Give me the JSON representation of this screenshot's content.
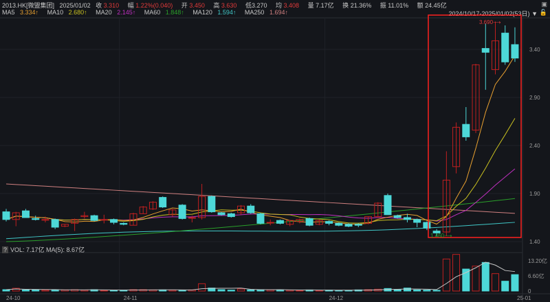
{
  "header": {
    "symbol": "2013.HK[微盟集团]",
    "date": "2025/01/02",
    "close_label": "收",
    "close": "3.310",
    "change_label": "幅",
    "change": "1.22%(0.040)",
    "open_label": "开",
    "open": "3.450",
    "high_label": "高",
    "high": "3.630",
    "low_label": "低",
    "low": "3.270",
    "avg_label": "均",
    "avg": "3.408",
    "volume_label": "量",
    "volume": "7.17亿",
    "turnover_label": "换",
    "turnover": "21.36%",
    "amplitude_label": "振",
    "amplitude": "11.01%",
    "amount_label": "额",
    "amount": "24.45亿",
    "date_range": "2024/10/17-2025/01/02(53日)"
  },
  "ma_legend": [
    {
      "label": "MA5",
      "value": "3.334↑",
      "color": "#e8a030"
    },
    {
      "label": "MA10",
      "value": "2.680↑",
      "color": "#c8c020"
    },
    {
      "label": "MA20",
      "value": "2.145↑",
      "color": "#c030c0"
    },
    {
      "label": "MA60",
      "value": "1.848↑",
      "color": "#2aa02a"
    },
    {
      "label": "MA120",
      "value": "1.594↑",
      "color": "#40c8c8"
    },
    {
      "label": "MA250",
      "value": "1.694↑",
      "color": "#d08080"
    }
  ],
  "volume_header": {
    "q": "?",
    "text": "VOL: 7.17亿 MA(5): 8.67亿"
  },
  "colors": {
    "up": "#c02020",
    "down": "#4dd8d8",
    "highlight": "#ff2020"
  },
  "chart_data": {
    "type": "candlestick",
    "price_ticks": [
      "3.40",
      "2.90",
      "2.40",
      "1.90",
      "1.40"
    ],
    "price_tick_values": [
      3.4,
      2.9,
      2.4,
      1.9,
      1.4
    ],
    "ylim": [
      1.4,
      3.7
    ],
    "volume_ticks": [
      "13.20亿",
      "6.60亿",
      "0"
    ],
    "volume_tick_values": [
      13.2,
      6.6,
      0
    ],
    "x_ticks": [
      {
        "label": "24-10",
        "index": 0
      },
      {
        "label": "24-11",
        "index": 12
      },
      {
        "label": "24-12",
        "index": 33
      },
      {
        "label": "25-01",
        "index": 53
      }
    ],
    "max_label": "3.690⟶",
    "min_label": "1.460⟶",
    "ohlc": [
      [
        1.71,
        1.74,
        1.61,
        1.63
      ],
      [
        1.63,
        1.71,
        1.56,
        1.7
      ],
      [
        1.72,
        1.74,
        1.66,
        1.65
      ],
      [
        1.64,
        1.67,
        1.62,
        1.63
      ],
      [
        1.63,
        1.66,
        1.6,
        1.63
      ],
      [
        1.63,
        1.64,
        1.53,
        1.55
      ],
      [
        1.56,
        1.58,
        1.55,
        1.58
      ],
      [
        1.59,
        1.64,
        1.51,
        1.63
      ],
      [
        1.66,
        1.71,
        1.64,
        1.67
      ],
      [
        1.67,
        1.68,
        1.61,
        1.62
      ],
      [
        1.63,
        1.68,
        1.59,
        1.63
      ],
      [
        1.63,
        1.64,
        1.58,
        1.6
      ],
      [
        1.59,
        1.6,
        1.57,
        1.58
      ],
      [
        1.57,
        1.7,
        1.57,
        1.69
      ],
      [
        1.69,
        1.77,
        1.69,
        1.76
      ],
      [
        1.74,
        1.82,
        1.73,
        1.81
      ],
      [
        1.86,
        1.87,
        1.75,
        1.76
      ],
      [
        1.68,
        1.74,
        1.66,
        1.73
      ],
      [
        1.78,
        1.79,
        1.63,
        1.64
      ],
      [
        1.65,
        1.67,
        1.6,
        1.65
      ],
      [
        1.65,
        2.0,
        1.63,
        1.87
      ],
      [
        1.87,
        1.88,
        1.7,
        1.71
      ],
      [
        1.7,
        1.71,
        1.67,
        1.68
      ],
      [
        1.69,
        1.7,
        1.65,
        1.66
      ],
      [
        1.7,
        1.78,
        1.68,
        1.77
      ],
      [
        1.77,
        1.79,
        1.69,
        1.7
      ],
      [
        1.69,
        1.7,
        1.58,
        1.59
      ],
      [
        1.6,
        1.63,
        1.57,
        1.6
      ],
      [
        1.62,
        1.63,
        1.58,
        1.59
      ],
      [
        1.58,
        1.62,
        1.56,
        1.62
      ],
      [
        1.61,
        1.64,
        1.59,
        1.63
      ],
      [
        1.64,
        1.65,
        1.56,
        1.57
      ],
      [
        1.58,
        1.63,
        1.57,
        1.62
      ],
      [
        1.61,
        1.62,
        1.57,
        1.59
      ],
      [
        1.59,
        1.6,
        1.56,
        1.57
      ],
      [
        1.58,
        1.59,
        1.55,
        1.56
      ],
      [
        1.58,
        1.59,
        1.55,
        1.57
      ],
      [
        1.59,
        1.66,
        1.58,
        1.66
      ],
      [
        1.66,
        1.81,
        1.65,
        1.8
      ],
      [
        1.88,
        1.9,
        1.68,
        1.68
      ],
      [
        1.67,
        1.68,
        1.64,
        1.65
      ],
      [
        1.65,
        1.69,
        1.6,
        1.63
      ],
      [
        1.63,
        1.64,
        1.55,
        1.6
      ],
      [
        1.6,
        1.61,
        1.52,
        1.54
      ],
      [
        1.51,
        1.53,
        1.46,
        1.49
      ],
      [
        1.5,
        2.34,
        1.46,
        2.04
      ],
      [
        2.18,
        2.64,
        2.11,
        2.59
      ],
      [
        2.62,
        2.8,
        2.45,
        2.49
      ],
      [
        2.56,
        3.25,
        2.53,
        3.24
      ],
      [
        3.41,
        3.67,
        2.98,
        3.37
      ],
      [
        3.19,
        3.69,
        3.14,
        3.49
      ],
      [
        3.57,
        3.65,
        3.24,
        3.27
      ],
      [
        3.45,
        3.63,
        3.27,
        3.31
      ]
    ],
    "volume": [
      0.6,
      1.2,
      0.5,
      0.5,
      0.4,
      0.6,
      0.5,
      0.6,
      0.4,
      0.6,
      0.3,
      0.4,
      0.4,
      0.6,
      0.6,
      0.5,
      0.5,
      0.4,
      0.4,
      0.5,
      3.2,
      1.3,
      0.6,
      0.4,
      0.9,
      0.5,
      0.6,
      0.5,
      0.5,
      0.4,
      0.3,
      0.5,
      0.3,
      0.4,
      0.3,
      0.3,
      0.5,
      0.6,
      0.8,
      1.1,
      0.7,
      1.3,
      0.5,
      0.4,
      0.3,
      14.0,
      16.0,
      9.6,
      10.9,
      12.5,
      7.6,
      4.3,
      7.17
    ],
    "ma60": [
      1.4,
      1.848
    ],
    "ma120": [
      1.43,
      1.594
    ],
    "ma250": [
      2.0,
      1.694
    ]
  }
}
